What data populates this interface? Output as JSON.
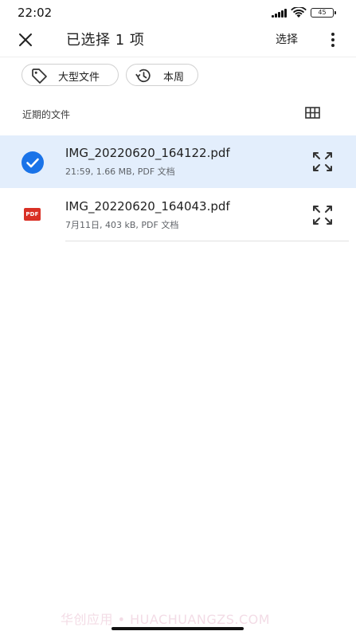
{
  "status_bar": {
    "time": "22:02",
    "battery": "45",
    "icons": [
      "signal-icon",
      "wifi-icon",
      "battery-icon"
    ]
  },
  "app_bar": {
    "title": "已选择 1 项",
    "select_label": "选择",
    "icons": [
      "close-icon",
      "more-vert-icon"
    ]
  },
  "filters": {
    "chips": [
      {
        "label": "大型文件",
        "icon": "tag-icon"
      },
      {
        "label": "本周",
        "icon": "history-icon"
      }
    ]
  },
  "recent": {
    "label": "近期的文件",
    "view_icon": "grid-view-icon"
  },
  "files": [
    {
      "name": "IMG_20220620_164122.pdf",
      "meta": "21:59, 1.66 MB, PDF 文档",
      "selected": true,
      "icon": "check-circle-icon"
    },
    {
      "name": "IMG_20220620_164043.pdf",
      "meta": "7月11日, 403 kB, PDF 文档",
      "selected": false,
      "icon": "pdf-file-icon",
      "icon_text": "PDF"
    }
  ],
  "watermark": "华创应用 • HUACHUANGZS.COM",
  "colors": {
    "accent": "#1a73e8",
    "selected_row": "#e3eefc",
    "pdf_red": "#d93025"
  }
}
